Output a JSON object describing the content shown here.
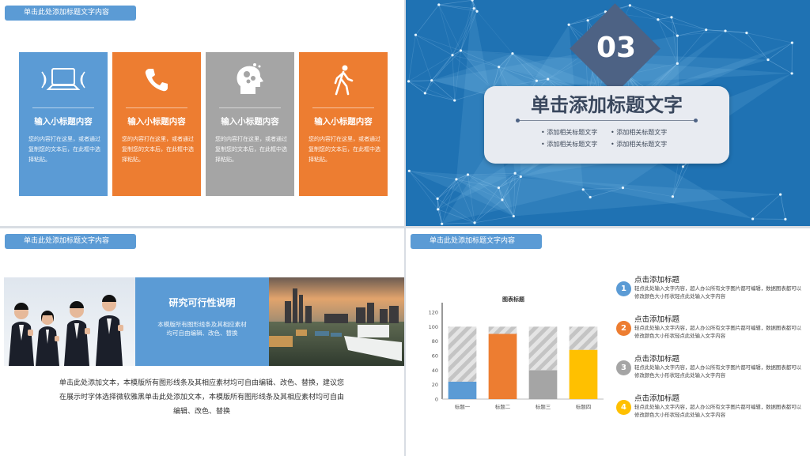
{
  "slide1": {
    "header": "单击此处添加标题文字内容",
    "cards": [
      {
        "icon": "laptop-icon",
        "title": "输入小标题内容",
        "body": "您的内容打在这里，或者通过复制您的文本后，在此框中选择粘贴。",
        "color": "#5b9bd5"
      },
      {
        "icon": "phone-icon",
        "title": "输入小标题内容",
        "body": "您的内容打在这里，或者通过复制您的文本后，在此框中选择粘贴。",
        "color": "#ed7d31"
      },
      {
        "icon": "head-gears-icon",
        "title": "输入小标题内容",
        "body": "您的内容打在这里，或者通过复制您的文本后，在此框中选择粘贴。",
        "color": "#a5a5a5"
      },
      {
        "icon": "walking-person-icon",
        "title": "输入小标题内容",
        "body": "您的内容打在这里，或者通过复制您的文本后，在此框中选择粘贴。",
        "color": "#ed7d31"
      }
    ]
  },
  "slide2": {
    "number": "03",
    "title": "单击添加标题文字",
    "items": [
      "• 添加相关标题文字",
      "• 添加相关标题文字",
      "• 添加相关标题文字",
      "• 添加相关标题文字"
    ]
  },
  "slide3": {
    "header": "单击此处添加标题文字内容",
    "box_title": "研究可行性说明",
    "box_body": "本模版所有图形线条及其相应素材均可自由编辑、改色、替换",
    "body_lines": [
      "单击此处添加文本，本模版所有图形线条及其相应素材均可自由编辑、改色、替换，建议您",
      "在展示时字体选择微软雅黑单击此处添加文本，本模版所有图形线条及其相应素材均可自由",
      "编辑、改色、替换"
    ]
  },
  "slide4": {
    "header": "单击此处添加标题文字内容",
    "chart_data": {
      "type": "bar",
      "title": "图表标题",
      "categories": [
        "标题一",
        "标题二",
        "标题三",
        "标题四"
      ],
      "series": [
        {
          "values": [
            24,
            90,
            40,
            68
          ],
          "colors": [
            "#5b9bd5",
            "#ed7d31",
            "#a5a5a5",
            "#ffc000"
          ]
        },
        {
          "values": [
            76,
            10,
            60,
            32
          ],
          "pattern": "gray-diagonal-stripes"
        }
      ],
      "ylim": [
        0,
        120
      ],
      "yticks": [
        "0",
        "20",
        "40",
        "60",
        "80",
        "100",
        "120"
      ],
      "stacked": true,
      "grid": false
    },
    "items": [
      {
        "num": "1",
        "title": "点击添加标题",
        "desc": "轻点此处输入文字内容，超人办公所有文字图片都可编辑，数据图表都可以修改颜色大小形状轻点此处输入文字内容",
        "color": "#5b9bd5"
      },
      {
        "num": "2",
        "title": "点击添加标题",
        "desc": "轻点此处输入文字内容，超人办公所有文字图片都可编辑，数据图表都可以修改颜色大小形状轻点此处输入文字内容",
        "color": "#ed7d31"
      },
      {
        "num": "3",
        "title": "点击添加标题",
        "desc": "轻点此处输入文字内容，超人办公所有文字图片都可编辑，数据图表都可以修改颜色大小形状轻点此处输入文字内容",
        "color": "#a5a5a5"
      },
      {
        "num": "4",
        "title": "点击添加标题",
        "desc": "轻点此处输入文字内容，超人办公所有文字图片都可编辑，数据图表都可以修改颜色大小形状轻点此处输入文字内容",
        "color": "#ffc000"
      }
    ]
  }
}
